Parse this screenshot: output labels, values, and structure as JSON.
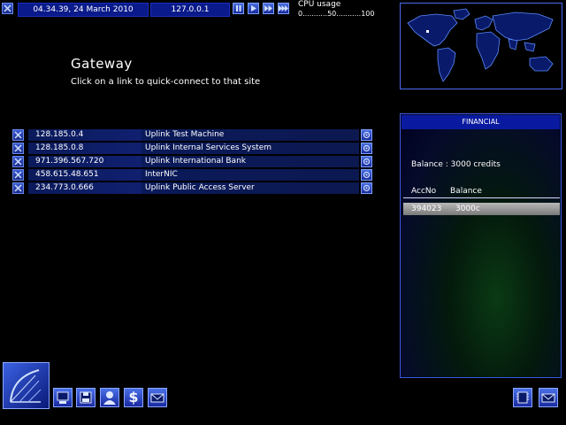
{
  "hud": {
    "datetime": "04.34.39, 24 March 2010",
    "ip": "127.0.0.1",
    "cpu_label": "CPU usage",
    "cpu_scale": "0...........50...........100"
  },
  "gateway": {
    "title": "Gateway",
    "subtitle": "Click on a link to quick-connect to that site",
    "links": [
      {
        "ip": "128.185.0.4",
        "name": "Uplink Test Machine"
      },
      {
        "ip": "128.185.0.8",
        "name": "Uplink Internal Services System"
      },
      {
        "ip": "971.396.567.720",
        "name": "Uplink International Bank"
      },
      {
        "ip": "458.615.48.651",
        "name": "InterNIC"
      },
      {
        "ip": "234.773.0.666",
        "name": "Uplink Public Access Server"
      }
    ]
  },
  "financial": {
    "title": "FINANCIAL",
    "balance": "Balance : 3000 credits",
    "col_accno": "AccNo",
    "col_balance": "Balance",
    "accounts": [
      {
        "accno": "394023",
        "balance": "3000c"
      }
    ]
  },
  "toolbar": {
    "dollar": "$"
  },
  "colors": {
    "accent": "#0a1a8a",
    "border": "#3a5ae0"
  }
}
